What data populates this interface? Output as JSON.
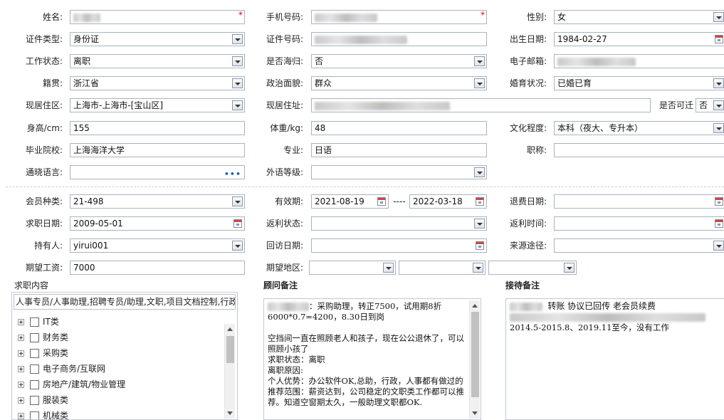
{
  "personal": {
    "name_label": "姓名:",
    "phone_label": "手机号码:",
    "gender_label": "性别:",
    "gender_value": "女",
    "id_type_label": "证件类型:",
    "id_type_value": "身份证",
    "id_number_label": "证件号码:",
    "birth_label": "出生日期:",
    "birth_value": "1984-02-27",
    "work_status_label": "工作状态:",
    "work_status_value": "离职",
    "returnee_label": "是否海归:",
    "returnee_value": "否",
    "email_label": "电子邮箱:",
    "native_label": "籍贯:",
    "native_value": "浙江省",
    "political_label": "政治面貌:",
    "political_value": "群众",
    "marital_label": "婚育状况:",
    "marital_value": "已婚已育",
    "district_label": "现居住区:",
    "district_value": "上海市-上海市-[宝山区]",
    "address_label": "现居住址:",
    "relocate_label": "是否可迁",
    "relocate_value": "否",
    "height_label": "身高/cm:",
    "height_value": "155",
    "weight_label": "体重/kg:",
    "weight_value": "48",
    "education_label": "文化程度:",
    "education_value": "本科（夜大、专升本）",
    "school_label": "毕业院校:",
    "school_value": "上海海洋大学",
    "major_label": "专业:",
    "major_value": "日语",
    "title_label": "职称:",
    "language_label": "通晓语言:",
    "language_level_label": "外语等级:",
    "required_mark": "*"
  },
  "membership": {
    "type_label": "会员种类:",
    "type_value": "21-498",
    "valid_label": "有效期:",
    "valid_from": "2021-08-19",
    "valid_sep": "----",
    "valid_to": "2022-03-18",
    "refund_label": "退费日期:",
    "job_date_label": "求职日期:",
    "job_date_value": "2009-05-01",
    "rebate_status_label": "返利状态:",
    "rebate_time_label": "返利时间:",
    "holder_label": "持有人:",
    "holder_value": "yirui001",
    "visit_label": "回访日期:",
    "source_label": "来源途径:",
    "salary_label": "期望工资:",
    "salary_value": "7000",
    "region_label": "期望地区:"
  },
  "job_panel": {
    "title": "求职内容",
    "summary": "人事专员/人事助理,招聘专员/助理,文职,项目文档控制,行政",
    "items": [
      "IT类",
      "财务类",
      "采购类",
      "电子商务/互联网",
      "房地产/建筑/物业管理",
      "服装类",
      "机械类"
    ]
  },
  "advisor_panel": {
    "title": "顾问备注",
    "lines": [
      "：采购助理，转正7500，试用期8折",
      "6000*0.7=4200，8.30日到岗",
      "",
      "空挡间一直在照顾老人和孩子，现在公公退休了，可以照顾小孩了",
      "求职状态：离职",
      "离职原因:",
      "个人优势：办公软件OK,总助，行政，人事都有做过的",
      "推荐范围：薪资达到，公司稳定的文职类工作都可以推荐。知道空窗期太久，一般助理文职都OK."
    ]
  },
  "reception_panel": {
    "title": "接待备注",
    "line1": "转账 协议已回传  老会员续费",
    "line3": "2014.5-2015.8、2019.11至今，没有工作"
  }
}
